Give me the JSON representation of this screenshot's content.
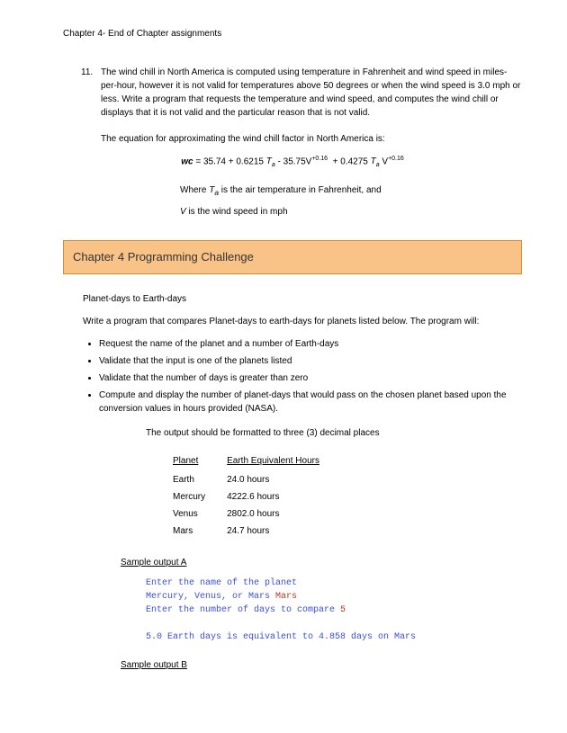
{
  "header": "Chapter 4- End of Chapter assignments",
  "q11": {
    "num": "11.",
    "text": "The wind chill in North America is computed using temperature in Fahrenheit and wind speed in miles-per-hour, however it is not valid for temperatures above 50 degrees or when the wind speed is 3.0 mph or less.  Write a program that requests the temperature and wind speed, and computes the wind chill or displays that it is not valid and the particular reason that is not valid.",
    "eq_intro": "The equation for approximating the wind chill factor in North America is:",
    "where1_pre": "Where ",
    "where1_sym": "Tₐ",
    "where1_post": " is the air temperature in Fahrenheit, and",
    "where2_sym": "V",
    "where2_post": " is the wind speed in mph"
  },
  "challenge_title": "Chapter 4 Programming Challenge",
  "planet": {
    "title": "Planet-days to Earth-days",
    "intro": "Write a program that compares Planet-days to earth-days for planets listed below. The program will:",
    "bullets": [
      "Request the name of the planet and a number of Earth-days",
      "Validate that the input is one of the planets listed",
      "Validate that the number of days is greater than zero",
      "Compute and display the number of planet-days that would pass on the chosen planet based upon the conversion values in hours provided (NASA)."
    ],
    "outnote": "The output should be formatted to three (3) decimal places",
    "table": {
      "h1": "Planet",
      "h2": "Earth Equivalent Hours",
      "rows": [
        {
          "p": "Earth",
          "h": "24.0 hours"
        },
        {
          "p": "Mercury",
          "h": "4222.6 hours"
        },
        {
          "p": "Venus",
          "h": "2802.0 hours"
        },
        {
          "p": "Mars",
          "h": "24.7 hours"
        }
      ]
    },
    "sampleA_hdr": "Sample output A",
    "sampleA": {
      "l1": "Enter the name of the planet",
      "l2a": "Mercury, Venus, or Mars ",
      "l2b": "Mars",
      "l3a": "Enter the number of days to compare ",
      "l3b": "5",
      "l4": "5.0 Earth days is equivalent to 4.858 days on Mars"
    },
    "sampleB_hdr": "Sample output B"
  },
  "chart_data": {
    "type": "table",
    "title": "Earth Equivalent Hours",
    "categories": [
      "Earth",
      "Mercury",
      "Venus",
      "Mars"
    ],
    "values": [
      24.0,
      4222.6,
      2802.0,
      24.7
    ],
    "xlabel": "Planet",
    "ylabel": "Earth Equivalent Hours"
  }
}
